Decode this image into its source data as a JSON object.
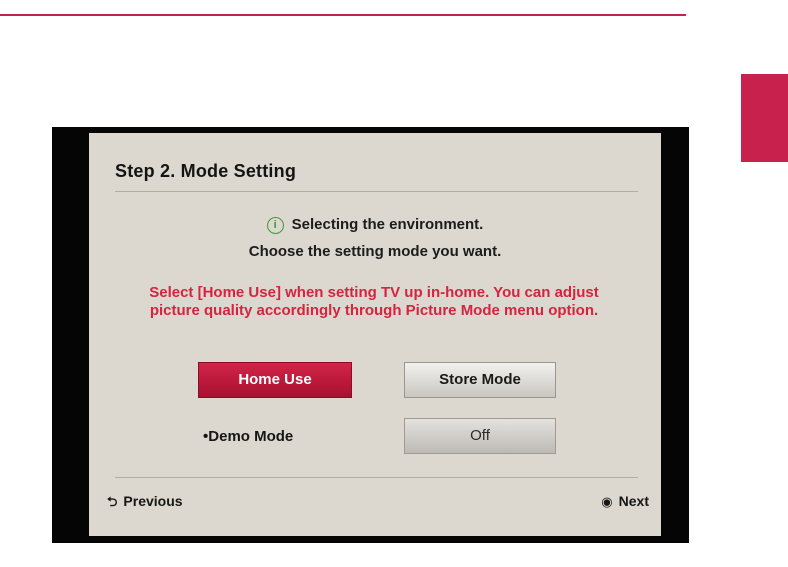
{
  "colors": {
    "accent": "#c8214d",
    "info_icon": "#3e9a3a",
    "warning_text": "#d4243f",
    "screen_bg": "#dcd8cf"
  },
  "dialog": {
    "title": "Step 2. Mode Setting",
    "info_icon": "info-circle-icon",
    "info_glyph": "i",
    "info_line_1": "Selecting the environment.",
    "info_line_2": "Choose the setting mode you want.",
    "warning": "Select [Home Use] when setting TV up in-home. You can adjust picture quality accordingly through Picture Mode menu option.",
    "buttons": {
      "home_use": "Home Use",
      "store_mode": "Store Mode"
    },
    "demo_mode": {
      "bullet": "•",
      "label": "Demo Mode",
      "value": "Off"
    }
  },
  "navigation": {
    "previous": {
      "icon": "back-arrow-icon",
      "glyph": "⮌",
      "label": "Previous"
    },
    "next": {
      "icon": "ok-button-icon",
      "glyph": "◉",
      "label": "Next"
    }
  }
}
